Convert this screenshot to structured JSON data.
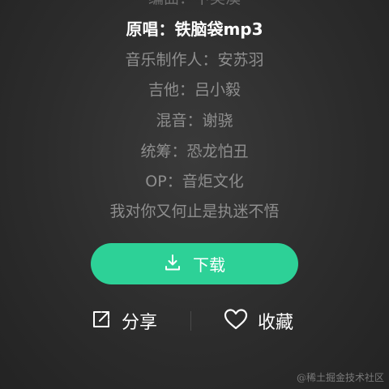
{
  "credits": {
    "top_cut": "编曲：卞英漠",
    "original": "原唱：铁脑袋mp3",
    "producer": "音乐制作人：安苏羽",
    "guitar": "吉他：吕小毅",
    "mix": "混音：谢骁",
    "coordinator": "统筹：恐龙怕丑",
    "op": "OP：音炬文化",
    "lyric": "我对你又何止是执迷不悟"
  },
  "download": {
    "label": "下载",
    "icon": "download-icon"
  },
  "actions": {
    "share_label": "分享",
    "share_icon": "share-icon",
    "favorite_label": "收藏",
    "favorite_icon": "heart-icon"
  },
  "watermark": "@稀土掘金技术社区",
  "colors": {
    "accent": "#2dd197",
    "text_dim": "#8e8e8e",
    "text_bright": "#ffffff"
  }
}
